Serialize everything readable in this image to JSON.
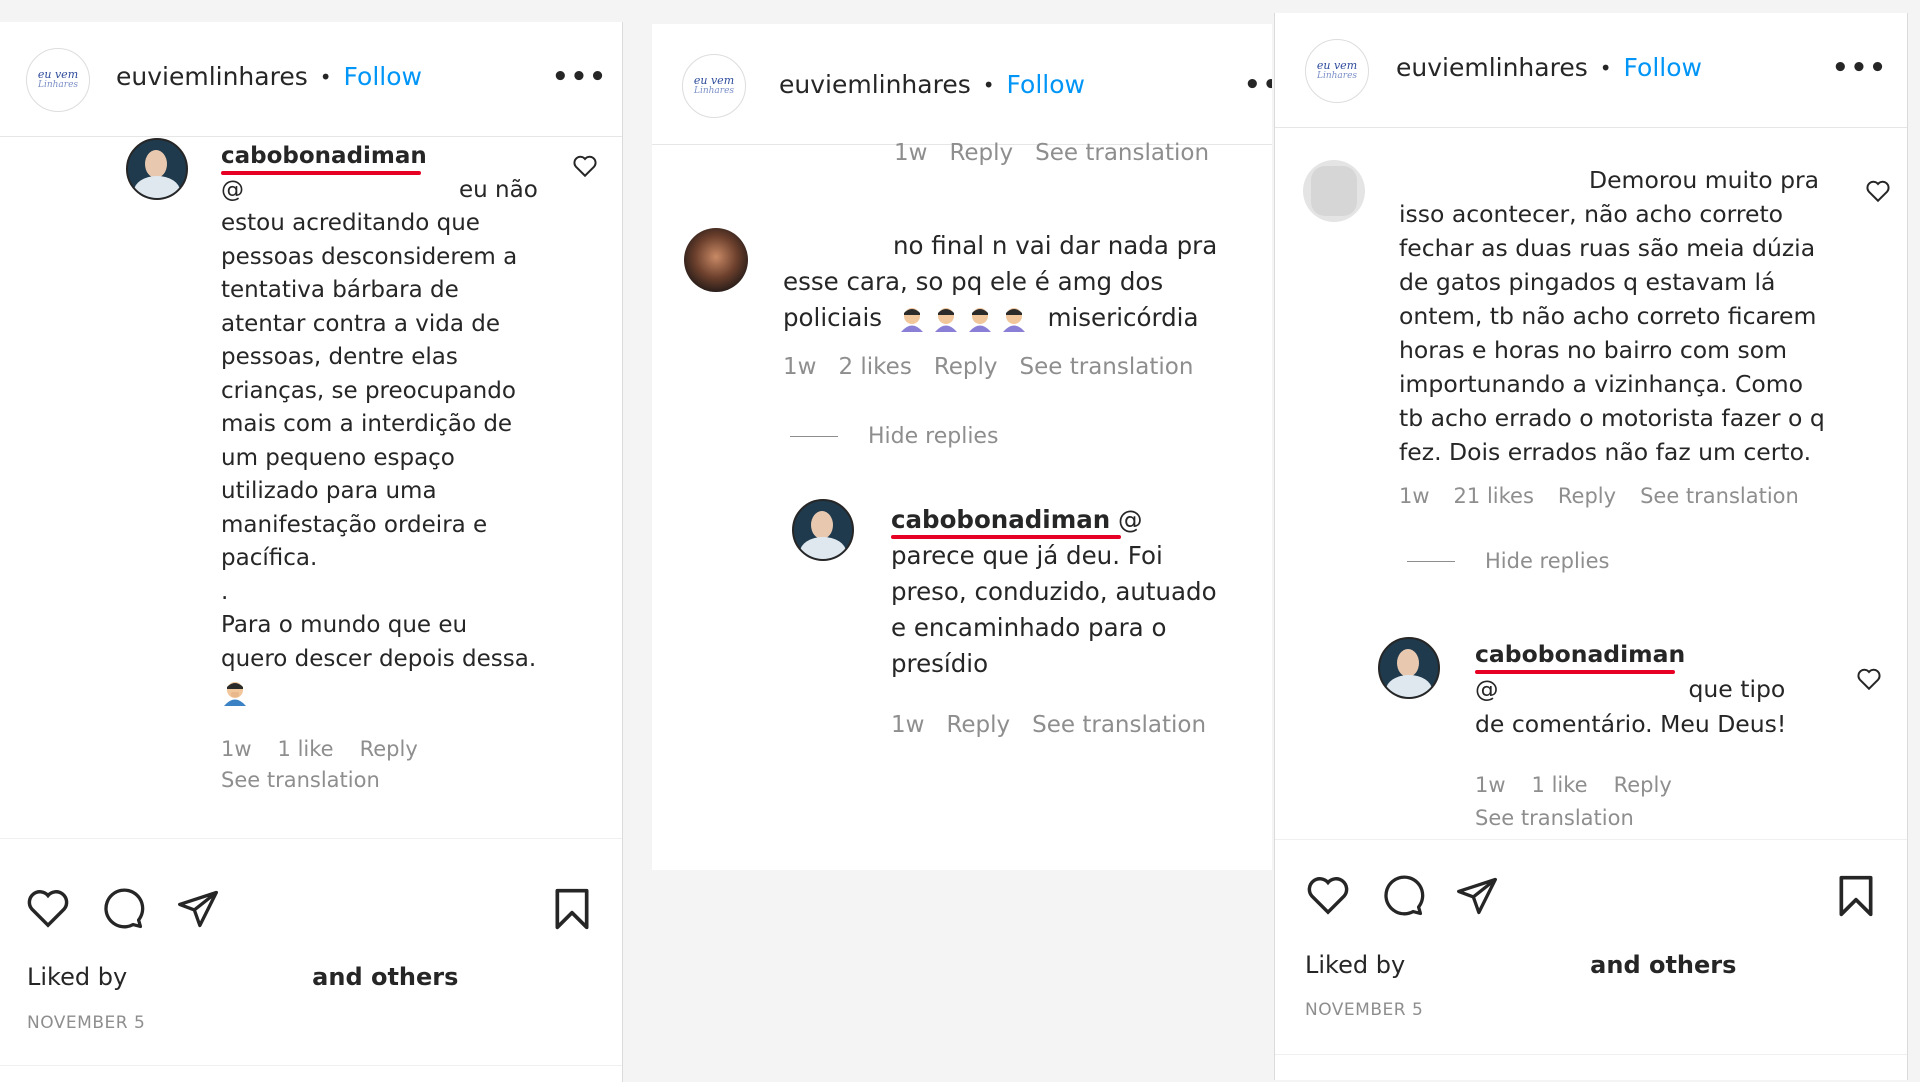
{
  "header": {
    "username": "euviemlinhares",
    "separator": "•",
    "follow": "Follow",
    "more": "•••",
    "logo_text": "eu vem",
    "logo_sub": "Linhares"
  },
  "panel1": {
    "comment": {
      "handle": "cabobonadiman",
      "mention": "@",
      "lines": [
        "eu não",
        "estou acreditando que",
        "pessoas desconsiderem a",
        "tentativa bárbara de",
        "atentar contra a vida de",
        "pessoas, dentre elas",
        "crianças, se preocupando",
        "mais com a interdição de",
        "um pequeno espaço",
        "utilizado para uma",
        "manifestação ordeira e",
        "pacífica.",
        ".",
        "Para o mundo que eu",
        "quero descer depois dessa."
      ],
      "time": "1w",
      "likes": "1 like",
      "reply": "Reply",
      "translation": "See translation"
    },
    "liked_by": "Liked by",
    "and_others": "and others",
    "date": "NOVEMBER 5"
  },
  "panel2": {
    "top_meta": {
      "time": "1w",
      "reply": "Reply",
      "translation": "See translation"
    },
    "comment": {
      "lines": [
        "no final n vai dar nada pra",
        "esse cara, so pq ele é amg dos",
        "policiais"
      ],
      "tail": "misericórdia",
      "time": "1w",
      "likes": "2 likes",
      "reply": "Reply",
      "translation": "See translation"
    },
    "hide_replies": "Hide replies",
    "reply": {
      "handle": "cabobonadiman",
      "mention": "@",
      "lines": [
        "parece que já deu. Foi",
        "preso, conduzido, autuado",
        "e encaminhado para o",
        "presídio"
      ],
      "time": "1w",
      "reply_label": "Reply",
      "translation": "See translation"
    }
  },
  "panel3": {
    "comment": {
      "lines": [
        "Demorou muito pra",
        "isso acontecer, não acho correto",
        "fechar as duas ruas são meia dúzia",
        "de gatos pingados q estavam lá",
        "ontem, tb não acho correto ficarem",
        "horas e horas no bairro com som",
        "importunando a vizinhança. Como",
        "tb acho errado o motorista fazer o q",
        "fez. Dois errados não faz um certo."
      ],
      "time": "1w",
      "likes": "21 likes",
      "reply": "Reply",
      "translation": "See translation"
    },
    "hide_replies": "Hide replies",
    "reply": {
      "handle": "cabobonadiman",
      "mention": "@",
      "lines": [
        "que tipo",
        "de comentário. Meu Deus!"
      ],
      "time": "1w",
      "likes": "1 like",
      "reply_label": "Reply",
      "translation": "See translation"
    },
    "liked_by": "Liked by",
    "and_others": "and others",
    "date": "NOVEMBER 5"
  },
  "colors": {
    "accent": "#0095f6",
    "underline": "#e60023",
    "muted": "#8e8e8e",
    "text": "#262626"
  }
}
